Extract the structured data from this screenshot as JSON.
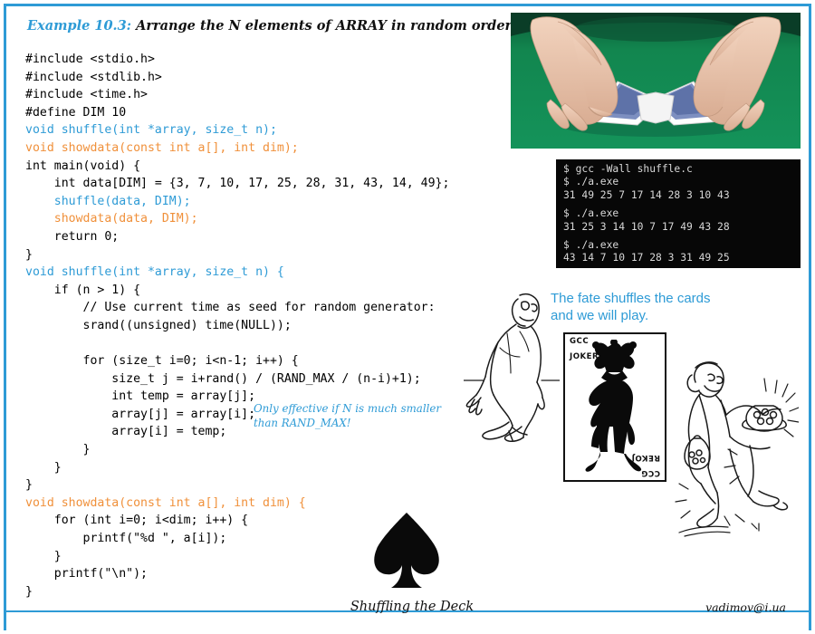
{
  "slide": {
    "title_prefix": "Example 10.3:",
    "title_text": " Arrange the N elements of ARRAY in random order.",
    "caption": "Shuffling the Deck",
    "credit": "vadimov@i.ua",
    "accent_color": "#2e9bd6",
    "code_keyword_color": "#f0903a"
  },
  "code": {
    "lines": [
      {
        "segments": [
          {
            "t": "#include <stdio.h>",
            "c": "black"
          }
        ]
      },
      {
        "segments": [
          {
            "t": "#include <stdlib.h>",
            "c": "black"
          }
        ]
      },
      {
        "segments": [
          {
            "t": "#include <time.h>",
            "c": "black"
          }
        ]
      },
      {
        "segments": [
          {
            "t": "#define DIM 10",
            "c": "black"
          }
        ]
      },
      {
        "segments": [
          {
            "t": "void shuffle(int *array, size_t n);",
            "c": "blue"
          }
        ]
      },
      {
        "segments": [
          {
            "t": "void showdata(const int a[], int dim);",
            "c": "orange"
          }
        ]
      },
      {
        "segments": [
          {
            "t": "int main(void) {",
            "c": "black"
          }
        ]
      },
      {
        "segments": [
          {
            "t": "    int data[DIM] = {3, 7, 10, 17, 25, 28, 31, 43, 14, 49};",
            "c": "black"
          }
        ]
      },
      {
        "segments": [
          {
            "t": "    shuffle(data, DIM);",
            "c": "blue"
          }
        ]
      },
      {
        "segments": [
          {
            "t": "    showdata(data, DIM);",
            "c": "orange"
          }
        ]
      },
      {
        "segments": [
          {
            "t": "    return 0;",
            "c": "black"
          }
        ]
      },
      {
        "segments": [
          {
            "t": "}",
            "c": "black"
          }
        ]
      },
      {
        "segments": [
          {
            "t": "void shuffle(int *array, size_t n) {",
            "c": "blue"
          }
        ]
      },
      {
        "segments": [
          {
            "t": "    if (n > 1) {",
            "c": "black"
          }
        ]
      },
      {
        "segments": [
          {
            "t": "        // Use current time as seed for random generator:",
            "c": "black"
          }
        ]
      },
      {
        "segments": [
          {
            "t": "        srand((unsigned) time(NULL));",
            "c": "black"
          }
        ]
      },
      {
        "segments": [
          {
            "t": "",
            "c": "black"
          }
        ]
      },
      {
        "segments": [
          {
            "t": "        for (size_t i=0; i<n-1; i++) {",
            "c": "black"
          }
        ]
      },
      {
        "segments": [
          {
            "t": "            size_t j = i+rand() / (RAND_MAX / (n-i)+1);",
            "c": "black"
          }
        ]
      },
      {
        "segments": [
          {
            "t": "            int temp = array[j];",
            "c": "black"
          }
        ]
      },
      {
        "segments": [
          {
            "t": "            array[j] = array[i];",
            "c": "black"
          }
        ]
      },
      {
        "segments": [
          {
            "t": "            array[i] = temp;",
            "c": "black"
          }
        ]
      },
      {
        "segments": [
          {
            "t": "        }",
            "c": "black"
          }
        ]
      },
      {
        "segments": [
          {
            "t": "    }",
            "c": "black"
          }
        ]
      },
      {
        "segments": [
          {
            "t": "}",
            "c": "black"
          }
        ]
      },
      {
        "segments": [
          {
            "t": "void showdata(const int a[], int dim) {",
            "c": "orange"
          }
        ]
      },
      {
        "segments": [
          {
            "t": "    for (int i=0; i<dim; i++) {",
            "c": "black"
          }
        ]
      },
      {
        "segments": [
          {
            "t": "        printf(\"%d \", a[i]);",
            "c": "black"
          }
        ]
      },
      {
        "segments": [
          {
            "t": "    }",
            "c": "black"
          }
        ]
      },
      {
        "segments": [
          {
            "t": "    printf(\"\\n\");",
            "c": "black"
          }
        ]
      },
      {
        "segments": [
          {
            "t": "}",
            "c": "black"
          }
        ]
      }
    ]
  },
  "annotation": {
    "line1": "Only effective if N is much smaller",
    "line2": "than RAND_MAX!"
  },
  "terminal": {
    "lines": [
      "$ gcc -Wall shuffle.c",
      "$ ./a.exe",
      "31 49 25 7 17 14 28 3 10 43",
      "$ ./a.exe",
      "31 25 3 14 10 7 17 49 43 28",
      "$ ./a.exe",
      "43 14 7 10 17 28 3 31 49 25"
    ],
    "background_color": "#070707",
    "text_color": "#d8d8d8"
  },
  "fate_note": {
    "line1": "The fate shuffles the",
    "line2": "cards and we will play."
  },
  "joker_card": {
    "label_top_left": "GCC",
    "label_bottom": "JOKER",
    "label_mirrored_top": "REKOJ",
    "label_mirrored_bottom": "CCG"
  },
  "photo": {
    "alt": "hands riffle-shuffling a deck of cards on a green felt table",
    "felt_color": "#12864f",
    "card_back_color": "#6b7fb0"
  },
  "icons": {
    "spade": "spade-icon",
    "sad_man": "sad-man-illustration",
    "happy_man": "happy-man-illustration"
  }
}
